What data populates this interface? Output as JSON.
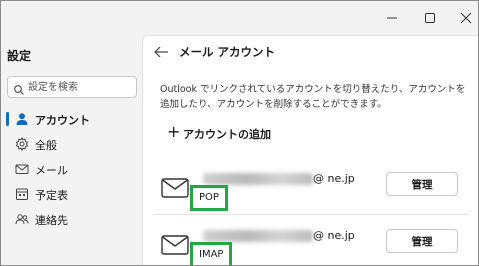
{
  "sidebar": {
    "title": "設定",
    "search_placeholder": "設定を検索",
    "items": [
      {
        "label": "アカウント",
        "icon": "person-icon",
        "active": true
      },
      {
        "label": "全般",
        "icon": "gear-icon",
        "active": false
      },
      {
        "label": "メール",
        "icon": "mail-icon",
        "active": false
      },
      {
        "label": "予定表",
        "icon": "calendar-icon",
        "active": false
      },
      {
        "label": "連絡先",
        "icon": "people-icon",
        "active": false
      }
    ]
  },
  "main": {
    "title": "メール アカウント",
    "description": "Outlook でリンクされているアカウントを切り替えたり、アカウントを追加したり、アカウントを削除することができます。",
    "add_account_label": "アカウントの追加",
    "accounts": [
      {
        "email_visible": "@        ne.jp",
        "email_domain_tail": "ne.jp",
        "protocol": "POP",
        "manage_label": "管理"
      },
      {
        "email_visible": "@        ne.jp",
        "email_domain_tail": "ne.jp",
        "protocol": "IMAP",
        "manage_label": "管理"
      }
    ]
  },
  "colors": {
    "accent": "#0f6cbd",
    "highlight_border": "#22a745"
  }
}
